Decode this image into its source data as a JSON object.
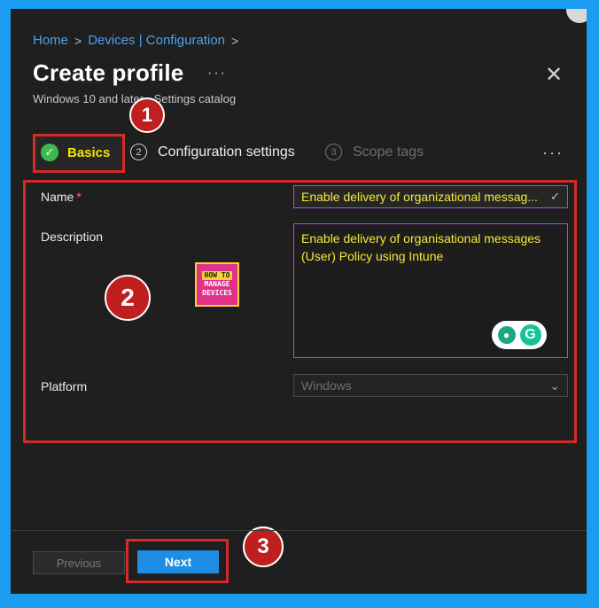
{
  "breadcrumb": {
    "home": "Home",
    "section": "Devices | Configuration"
  },
  "header": {
    "title": "Create profile",
    "more": "···",
    "subtitle": "Windows 10 and later - Settings catalog",
    "close": "✕"
  },
  "callouts": {
    "one": "1",
    "two": "2",
    "three": "3"
  },
  "tabs": [
    {
      "label": "Basics",
      "state": "completed",
      "icon": "check-icon"
    },
    {
      "label": "Configuration settings",
      "number": "2",
      "state": "enabled"
    },
    {
      "label": "Scope tags",
      "number": "3",
      "state": "disabled"
    }
  ],
  "tabs_more": "···",
  "form": {
    "name_label": "Name",
    "required_mark": "*",
    "name_value": "Enable delivery of organizational messag...",
    "name_check": "✓",
    "description_label": "Description",
    "description_value": "Enable delivery of organisational messages (User) Policy using Intune",
    "platform_label": "Platform",
    "platform_value": "Windows",
    "platform_chevron": "⌵"
  },
  "logo": {
    "line1": "HOW TO",
    "line2": "MANAGE",
    "line3": "DEVICES"
  },
  "grammarly": {
    "bulb": "💡",
    "letter": "G"
  },
  "footer": {
    "previous_label": "Previous",
    "next_label": "Next"
  },
  "colors": {
    "background": "#1a9cf0",
    "panel": "#1f1f1f",
    "link": "#4aa3f0",
    "highlight_text": "#f4ea3a",
    "callout": "#c01f1f",
    "primary_button": "#1e8de3"
  }
}
